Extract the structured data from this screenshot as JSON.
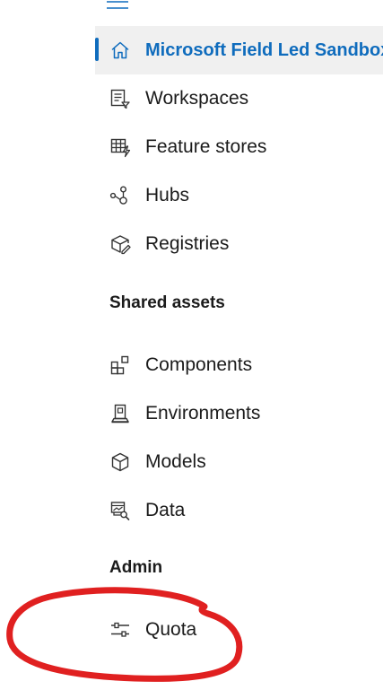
{
  "nav": {
    "home_label": "Microsoft Field Led Sandbox",
    "workspaces_label": "Workspaces",
    "feature_stores_label": "Feature stores",
    "hubs_label": "Hubs",
    "registries_label": "Registries"
  },
  "shared_assets": {
    "heading": "Shared assets",
    "components_label": "Components",
    "environments_label": "Environments",
    "models_label": "Models",
    "data_label": "Data"
  },
  "admin": {
    "heading": "Admin",
    "quota_label": "Quota"
  },
  "icons": {
    "menu": "hamburger-icon",
    "home": "home-icon",
    "workspaces": "workspaces-icon",
    "feature_stores": "feature-store-icon",
    "hubs": "hubs-icon",
    "registries": "registries-icon",
    "components": "components-icon",
    "environments": "environments-icon",
    "models": "models-icon",
    "data": "data-icon",
    "quota": "quota-icon"
  },
  "colors": {
    "accent": "#0f6cbd",
    "selected_background": "#f0f0f0",
    "annotation": "#e02020"
  }
}
